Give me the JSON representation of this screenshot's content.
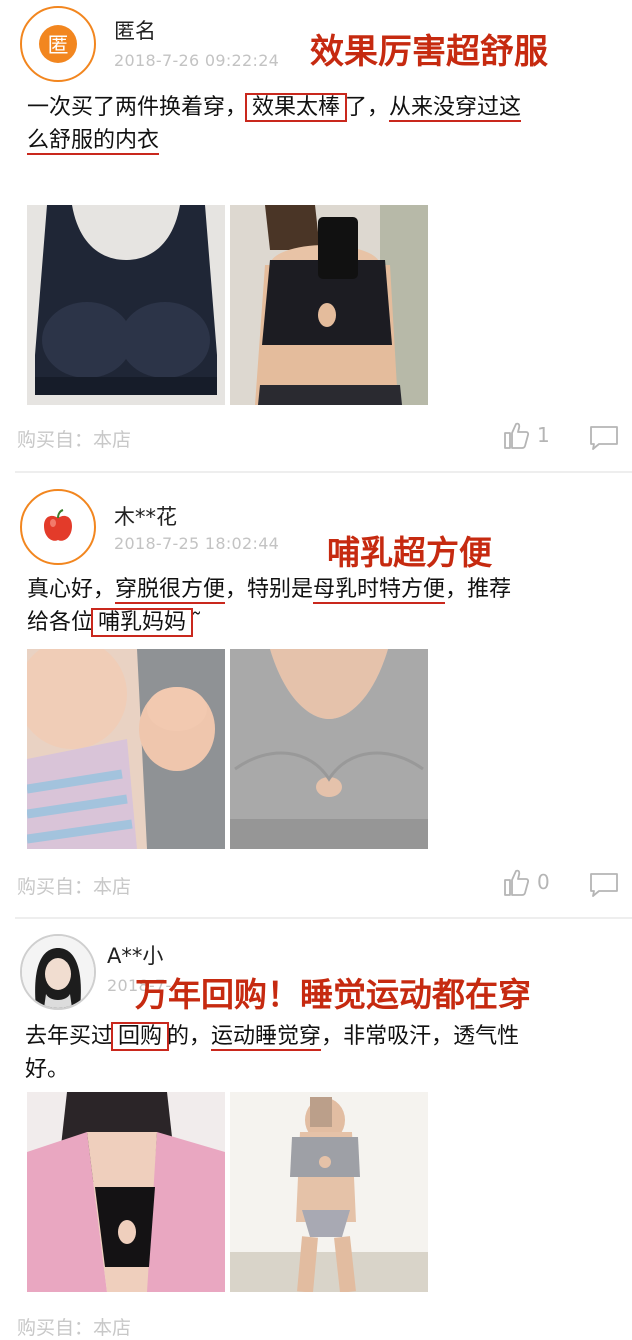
{
  "reviews": [
    {
      "avatar_letter": "匿",
      "user": "匿名",
      "time": "2018-7-26 09:22:24",
      "overlay": "效果厉害超舒服",
      "text": {
        "t1": "一次买了两件换着穿，",
        "t2": "效果太棒",
        "t3": "了，",
        "t4": "从来没穿过这",
        "t5": "么舒服的内衣"
      },
      "photos": [
        "navy-bra-flatlay",
        "navy-bra-worn-selfie"
      ],
      "purchase": "购买自：本店",
      "likes": "1"
    },
    {
      "user": "木**花",
      "time": "2018-7-25 18:02:44",
      "overlay": "哺乳超方便",
      "text": {
        "t1": "真心好，",
        "t2": "穿脱很方便",
        "t3": "，特别是",
        "t4": "母乳时特方便",
        "t5": "，推荐",
        "t6": "给各位",
        "t7": "哺乳妈妈",
        "t8": "˜"
      },
      "photos": [
        "baby-nursing",
        "gray-bra-closeup"
      ],
      "purchase": "购买自：本店",
      "likes": "0"
    },
    {
      "user": "A**小",
      "time": "2018-7-",
      "overlay": "万年回购！睡觉运动都在穿",
      "text": {
        "t1": "去年买过",
        "t2": "回购",
        "t3": "的，",
        "t4": "运动睡觉穿",
        "t5": "，非常吸汗，透气性",
        "t6": "好。"
      },
      "photos": [
        "pink-jacket-bra",
        "gray-bra-mirror-selfie"
      ],
      "purchase": "购买自：本店"
    }
  ],
  "colors": {
    "accent": "#f2861f",
    "highlight": "#c9281d",
    "muted": "#c3c3c3"
  },
  "icons": [
    "thumbs-up-icon",
    "comment-icon",
    "apple-icon"
  ]
}
